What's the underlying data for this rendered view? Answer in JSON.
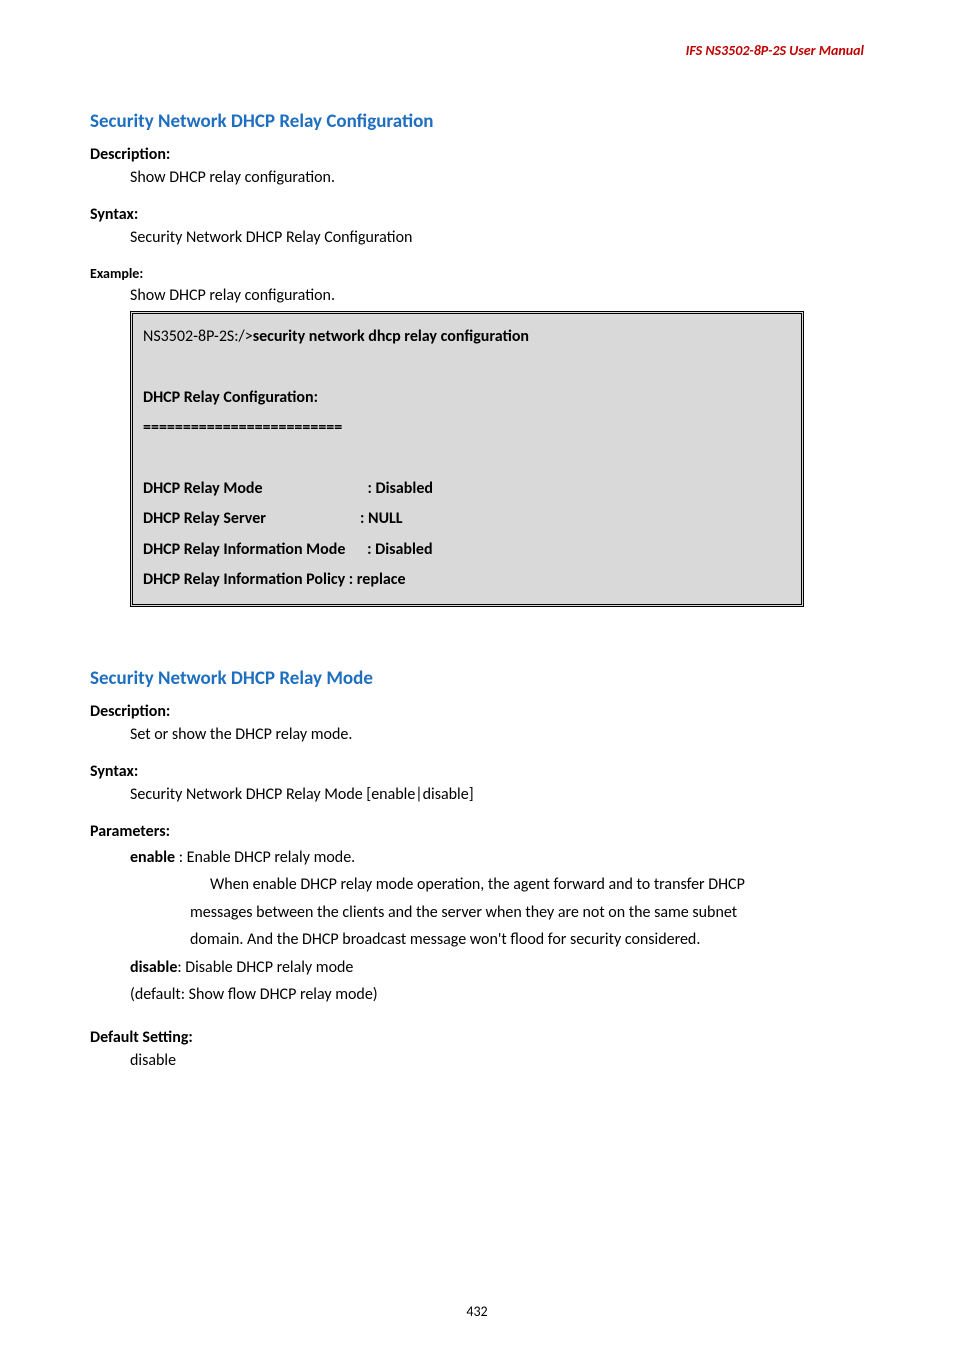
{
  "header": {
    "product": "IFS  NS3502-8P-2S  User  Manual"
  },
  "section1": {
    "title": "Security Network DHCP Relay Configuration",
    "descLabel": "Description:",
    "descText": "Show DHCP relay configuration.",
    "syntaxLabel": "Syntax:",
    "syntaxText": "Security Network DHCP Relay Configuration",
    "exampleLabel": "Example:",
    "exampleText": "Show DHCP relay configuration.",
    "terminal": {
      "promptPrefix": "NS3502-8P-2S:/>",
      "command": "security network dhcp relay configuration",
      "blank1": " ",
      "confTitle": "DHCP Relay Configuration:",
      "divider": "=========================",
      "blank2": " ",
      "row1a": "DHCP Relay Mode                             : Disabled",
      "row2a": "DHCP Relay Server                          : NULL",
      "row3a": "DHCP Relay Information Mode      : Disabled",
      "row4a": "DHCP Relay Information Policy : replace"
    }
  },
  "section2": {
    "title": "Security Network DHCP Relay Mode",
    "descLabel": "Description:",
    "descText": "Set or show the DHCP relay mode.",
    "syntaxLabel": "Syntax:",
    "syntaxText": "Security Network DHCP Relay Mode [enable|disable]",
    "paramsLabel": "Parameters:",
    "enableBold": "enable",
    "enableRest": " : Enable DHCP relaly mode.",
    "enableLine2": "  When enable DHCP relay mode operation, the agent forward and to transfer DHCP",
    "enableLine3": "messages between the clients and the server when they are not on the same subnet",
    "enableLine4": "domain. And the DHCP broadcast message won't flood for security considered.",
    "disableBold": "disable",
    "disableRest": ": Disable DHCP relaly mode",
    "defaultLine": "(default: Show flow DHCP relay mode)",
    "defaultLabel": "Default Setting:",
    "defaultValue": "disable"
  },
  "footer": {
    "pageNumber": "432"
  }
}
